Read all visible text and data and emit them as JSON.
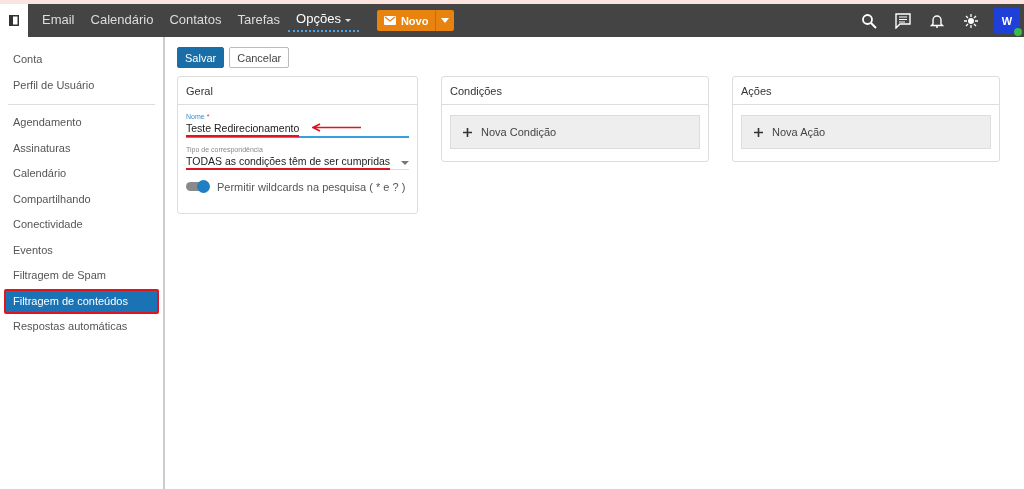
{
  "topbar": {
    "nav": [
      {
        "label": "Email",
        "selected": false
      },
      {
        "label": "Calendário",
        "selected": false
      },
      {
        "label": "Contatos",
        "selected": false
      },
      {
        "label": "Tarefas",
        "selected": false
      },
      {
        "label": "Opções",
        "selected": true,
        "kind": "menu"
      }
    ],
    "new_button": "Novo",
    "avatar": "W",
    "online": true
  },
  "sidebar": {
    "groups": [
      [
        {
          "label": "Conta",
          "selected": false,
          "highlighted": false
        },
        {
          "label": "Perfil de Usuário",
          "selected": false,
          "highlighted": false
        }
      ],
      [
        {
          "label": "Agendamento",
          "selected": false,
          "highlighted": false
        },
        {
          "label": "Assinaturas",
          "selected": false,
          "highlighted": false
        },
        {
          "label": "Calendário",
          "selected": false,
          "highlighted": false
        },
        {
          "label": "Compartilhando",
          "selected": false,
          "highlighted": false
        },
        {
          "label": "Conectividade",
          "selected": false,
          "highlighted": false
        },
        {
          "label": "Eventos",
          "selected": false,
          "highlighted": false
        },
        {
          "label": "Filtragem de Spam",
          "selected": false,
          "highlighted": false
        },
        {
          "label": "Filtragem de conteúdos",
          "selected": true,
          "highlighted": true
        },
        {
          "label": "Respostas automáticas",
          "selected": false,
          "highlighted": false
        }
      ]
    ]
  },
  "toolbar": {
    "save": "Salvar",
    "cancel": "Cancelar"
  },
  "general": {
    "title": "Geral",
    "name_field": {
      "label": "Nome",
      "required_mark": "*",
      "value": "Teste Redirecionamento",
      "underlined": true,
      "arrow": true
    },
    "match_field": {
      "label": "Tipo de correspondência",
      "value": "TODAS as condições têm de ser cumpridas",
      "underlined": true
    },
    "wildcards": {
      "label": "Permitir wildcards na pesquisa ( * e ? )",
      "on": true
    }
  },
  "conditions": {
    "title": "Condições",
    "add": "Nova Condição"
  },
  "actions": {
    "title": "Ações",
    "add": "Nova Ação"
  }
}
